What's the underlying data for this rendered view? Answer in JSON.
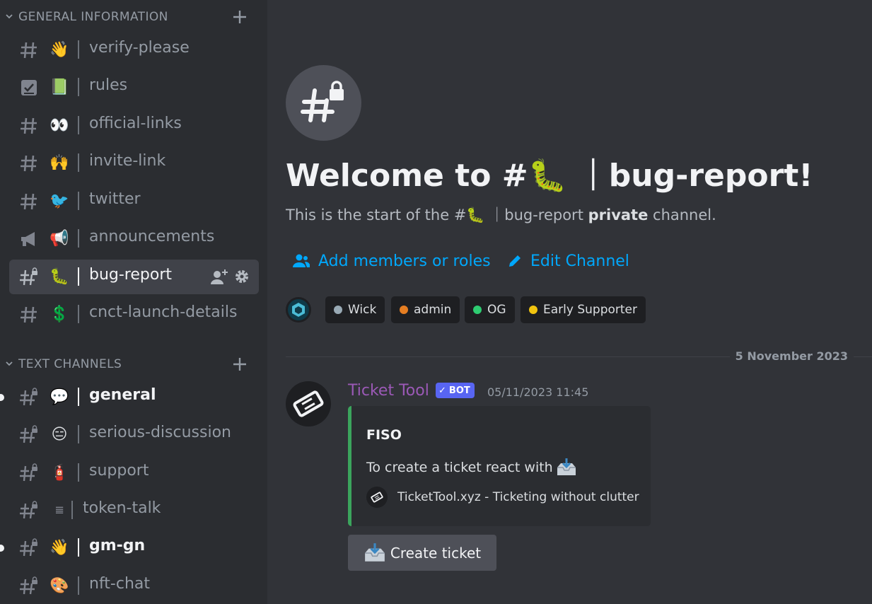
{
  "sidebar": {
    "categories": [
      {
        "label": "GENERAL INFORMATION"
      },
      {
        "label": "TEXT CHANNELS"
      }
    ],
    "channels": [
      {
        "name": "verify-please",
        "emoji": "👋"
      },
      {
        "name": "rules",
        "emoji": "📗"
      },
      {
        "name": "official-links",
        "emoji": "👀"
      },
      {
        "name": "invite-link",
        "emoji": "🙌"
      },
      {
        "name": "twitter",
        "emoji": "🐦"
      },
      {
        "name": "announcements",
        "emoji": "📢"
      },
      {
        "name": "bug-report",
        "emoji": "🐛"
      },
      {
        "name": "cnct-launch-details",
        "emoji": "💲"
      },
      {
        "name": "general",
        "emoji": "💬"
      },
      {
        "name": "serious-discussion",
        "emoji": "😑"
      },
      {
        "name": "support",
        "emoji": "🧯"
      },
      {
        "name": "token-talk",
        "emoji": "𝌆"
      },
      {
        "name": "gm-gn",
        "emoji": "👋"
      },
      {
        "name": "nft-chat",
        "emoji": "🎨"
      }
    ]
  },
  "welcome": {
    "title": "Welcome to #🐛 ｜bug-report!",
    "subtitle_start": "This is the start of the #🐛 ｜bug-report ",
    "subtitle_bold": "private",
    "subtitle_end": " channel.",
    "add_members": "Add members or roles",
    "edit_channel": "Edit Channel"
  },
  "roles": [
    {
      "name": "Wick",
      "color": "#99aab5"
    },
    {
      "name": "admin",
      "color": "#e67e22"
    },
    {
      "name": "OG",
      "color": "#2ecc71"
    },
    {
      "name": "Early Supporter",
      "color": "#f1c40f"
    }
  ],
  "date_divider": "5 November 2023",
  "message": {
    "author": "Ticket Tool",
    "bot_tag": "BOT",
    "timestamp": "05/11/2023 11:45",
    "embed": {
      "title": "FISO",
      "description": "To create a ticket react with",
      "footer": "TicketTool.xyz - Ticketing without clutter",
      "accent": "#3ba55d"
    },
    "button": "Create ticket"
  },
  "colors": {
    "link": "#00a8fc",
    "author": "#9b59b6",
    "bot_tag": "#5865f2"
  }
}
